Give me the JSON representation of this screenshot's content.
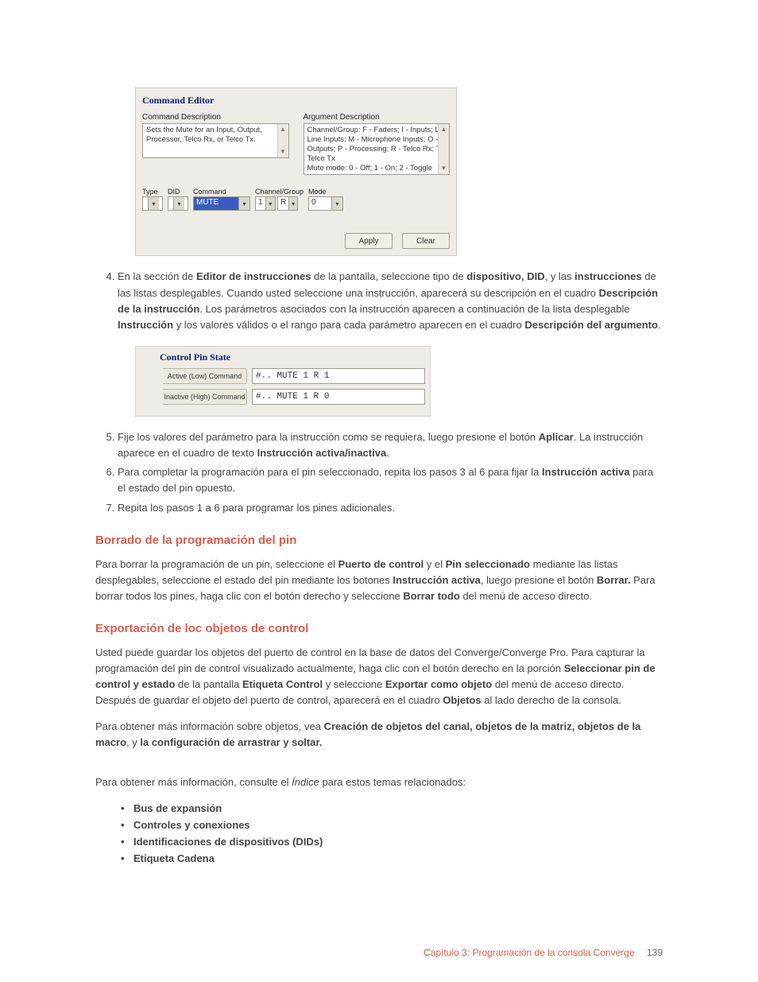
{
  "command_editor": {
    "title": "Command Editor",
    "cmd_desc_label": "Command Description",
    "arg_desc_label": "Argument Description",
    "cmd_desc_text": "Sets the Mute for an Input, Output, Processor, Telco Rx, or Telco Tx.",
    "arg_desc_text": "Channel/Group: F - Faders; I - Inputs; L - Line Inputs; M - Microphone Inputs; O - Outputs; P - Processing; R - Telco Rx; T - Telco Tx\nMute mode: 0 - Off; 1 - On; 2 - Toggle",
    "labels": {
      "type": "Type",
      "did": "DID",
      "command": "Command",
      "chgrp": "Channel/Group",
      "mode": "Mode"
    },
    "values": {
      "type": "",
      "did": "",
      "command": "MUTE",
      "ch": "1",
      "grp": "R",
      "mode": "0"
    },
    "buttons": {
      "apply": "Apply",
      "clear": "Clear"
    }
  },
  "steps_first": {
    "s4_pre": "En la sección de ",
    "s4_b1": "Editor de instrucciones",
    "s4_mid1": " de la pantalla, seleccione tipo de ",
    "s4_b2": "dispositivo, DID",
    "s4_mid2": ", y las ",
    "s4_b3": "instrucciones",
    "s4_mid3": " de las listas desplegables. Cuando usted seleccione una instrucción, aparecerá su descripción en el cuadro ",
    "s4_b4": "Descripción de la instrucción",
    "s4_mid4": ". Los parámetros asociados con la instrucción aparecen a continuación de la lista desplegable ",
    "s4_b5": "Instrucción",
    "s4_mid5": " y los valores válidos o el rango para cada parámetro aparecen en el cuadro ",
    "s4_b6": "Descripción del argumento",
    "s4_end": "."
  },
  "control_pin_state": {
    "title": "Control Pin State",
    "active_label": "Active (Low) Command",
    "inactive_label": "Inactive (High) Command",
    "active_value": "#.. MUTE 1 R 1",
    "inactive_value": "#.. MUTE 1 R 0"
  },
  "steps_second": {
    "s5_pre": "Fije los valores del parámetro para la instrucción como se requiera, luego presione el botón ",
    "s5_b1": "Aplicar",
    "s5_mid1": ". La instrucción aparece en el cuadro de texto ",
    "s5_b2": "Instrucción activa/inactiva",
    "s5_end": ".",
    "s6_pre": "Para completar la programación para el pin seleccionado, repita los pasos 3 al 6 para fijar la ",
    "s6_b1": "Instrucción activa",
    "s6_end": " para el estado del pin opuesto.",
    "s7": "Repita los pasos 1 a 6 para programar los pines adicionales."
  },
  "sec1": {
    "h": "Borrado de la programación del pin",
    "p_pre": "Para borrar la programación de un pin, seleccione el ",
    "p_b1": "Puerto de control",
    "p_m1": " y el ",
    "p_b2": "Pin seleccionado",
    "p_m2": " mediante las listas desplegables, seleccione el estado del pin mediante los botones ",
    "p_b3": "Instrucción activa",
    "p_m3": ", luego presione el botón ",
    "p_b4": "Borrar.",
    "p_m4": " Para borrar todos los pines, haga clic con el botón derecho y seleccione ",
    "p_b5": "Borrar todo",
    "p_end": " del menú de acceso directo."
  },
  "sec2": {
    "h": "Exportación de loc objetos de control",
    "p1_pre": "Usted puede guardar los objetos del puerto de control en la base de datos del Converge/Converge Pro. Para capturar la programación del pin de control visualizado actualmente, haga clic con el botón derecho en la porción ",
    "p1_b1": "Seleccionar pin de control y estado",
    "p1_m1": " de la pantalla ",
    "p1_b2": "Etiqueta Control",
    "p1_m2": " y seleccione ",
    "p1_b3": "Exportar como objeto",
    "p1_m3": " del menú de acceso directo. Después de guardar el objeto del puerto de control, aparecerá en el cuadro ",
    "p1_b4": "Objetos",
    "p1_end": " al lado derecho de la consola.",
    "p2_pre": "Para obtener más información sobre objetos, vea ",
    "p2_b1": "Creación de objetos del canal, objetos de la matriz, objetos de la macro",
    "p2_m1": ", y ",
    "p2_b2": "la configuración de arrastrar y soltar."
  },
  "moreinfo": {
    "pre": "Para obtener más información, consulte el ",
    "it": "Índice",
    "post": " para estos temas relacionados:"
  },
  "bullets": [
    "Bus de expansión",
    "Controles y conexiones",
    "Identificaciones de dispositivos (DIDs)",
    "Etiqueta Cadena"
  ],
  "footer": {
    "chapter": "Capítulo 3: Programación de la consola Converge",
    "page": "139"
  }
}
